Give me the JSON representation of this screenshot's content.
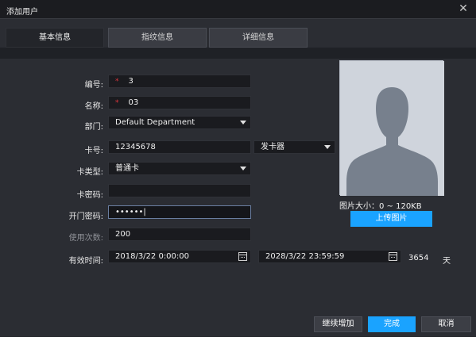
{
  "window": {
    "title": "添加用户",
    "close_icon": "close-icon"
  },
  "tabs": [
    {
      "label": "基本信息",
      "active": true
    },
    {
      "label": "指纹信息",
      "active": false
    },
    {
      "label": "详细信息",
      "active": false
    }
  ],
  "form": {
    "id": {
      "label": "编号:",
      "required_mark": "*",
      "value": "3"
    },
    "name": {
      "label": "名称:",
      "required_mark": "*",
      "value": "03"
    },
    "department": {
      "label": "部门:",
      "value": "Default Department"
    },
    "card_no": {
      "label": "卡号:",
      "value": "12345678",
      "issuer": "发卡器"
    },
    "card_type": {
      "label": "卡类型:",
      "value": "普通卡"
    },
    "card_password": {
      "label": "卡密码:",
      "value": ""
    },
    "door_password": {
      "label": "开门密码:",
      "value": "••••••"
    },
    "use_count": {
      "label": "使用次数:",
      "value": "200"
    },
    "validity": {
      "label": "有效时间:",
      "start": "2018/3/22 0:00:00",
      "end": "2028/3/22 23:59:59",
      "days": "3654",
      "unit": "天"
    }
  },
  "photo": {
    "size_info": "图片大小：0 ~ 120KB",
    "upload_label": "上传图片",
    "placeholder_icon": "user-silhouette-icon"
  },
  "footer": {
    "continue_label": "继续增加",
    "done_label": "完成",
    "cancel_label": "取消"
  },
  "colors": {
    "accent": "#1aa3ff",
    "required": "#e0363d",
    "background": "#2b2d33"
  }
}
